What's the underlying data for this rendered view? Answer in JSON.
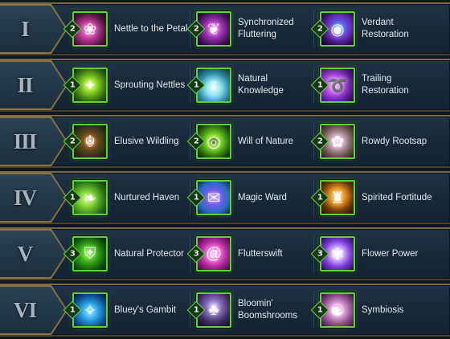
{
  "tiers": [
    {
      "numeral": "I",
      "slots": [
        {
          "name": "Nettle to the Petal",
          "rank": "2",
          "icon": "rose-icon",
          "bg": "radial-gradient(circle at 45% 55%, #f08fd0 0%, #c0389a 35%, #4a1338 70%, #1c0a18 100%)",
          "glyph": "❀"
        },
        {
          "name": "Synchronized Fluttering",
          "rank": "2",
          "icon": "butterfly-icon",
          "bg": "radial-gradient(circle at 50% 50%, #f27de9 0%, #9b2fb0 40%, #3c1050 75%, #150820 100%)",
          "glyph": "❦"
        },
        {
          "name": "Verdant Restoration",
          "rank": "2",
          "icon": "vortex-orb-icon",
          "bg": "radial-gradient(circle at 55% 45%, #8ad7ff 0%, #4a68e6 18%, #6d2fc4 45%, #2a1050 75%, #0c0620 100%)",
          "glyph": "◉"
        }
      ]
    },
    {
      "numeral": "II",
      "slots": [
        {
          "name": "Sprouting Nettles",
          "rank": "1",
          "icon": "sprout-burst-icon",
          "bg": "radial-gradient(circle at 50% 50%, #e9ff7a 0%, #8fd82a 30%, #3f7b14 65%, #122808 100%)",
          "glyph": "✦"
        },
        {
          "name": "Natural Knowledge",
          "rank": "1",
          "icon": "glowing-tree-icon",
          "bg": "radial-gradient(circle at 50% 60%, #e7ffff 0%, #8fe3f2 30%, #2d8ea5 60%, #0d2b38 100%)",
          "glyph": "♆"
        },
        {
          "name": "Trailing Restoration",
          "rank": "1",
          "icon": "swirl-trail-icon",
          "bg": "radial-gradient(circle at 40% 50%, #f0a6ff 0%, #b44ee2 35%, #5b1b93 70%, #1b0a30 100%)",
          "glyph": "➰"
        }
      ]
    },
    {
      "numeral": "III",
      "slots": [
        {
          "name": "Elusive Wildling",
          "rank": "2",
          "icon": "wildling-face-icon",
          "bg": "radial-gradient(circle at 50% 50%, #e08a2a 0%, #7a4a1a 30%, #2f3a16 65%, #101a08 100%)",
          "glyph": "☬"
        },
        {
          "name": "Will of Nature",
          "rank": "2",
          "icon": "green-spiral-icon",
          "bg": "radial-gradient(circle at 50% 50%, #1d3a08 0%, #8ee62a 25%, #4ea51a 50%, #1d4a0a 80%, #0c1e05 100%)",
          "glyph": "◎"
        },
        {
          "name": "Rowdy Rootsap",
          "rank": "2",
          "icon": "root-tendril-icon",
          "bg": "radial-gradient(circle at 50% 50%, #f6e0f0 0%, #c9a0b8 30%, #6a5a4a 65%, #221a14 100%)",
          "glyph": "✿"
        }
      ]
    },
    {
      "numeral": "IV",
      "slots": [
        {
          "name": "Nurtured Haven",
          "rank": "1",
          "icon": "haven-leaf-icon",
          "bg": "radial-gradient(circle at 40% 55%, #d8ff8a 0%, #7fd335 30%, #2f7a18 65%, #0e2508 100%)",
          "glyph": "❧"
        },
        {
          "name": "Magic Ward",
          "rank": "1",
          "icon": "scroll-ward-icon",
          "bg": "radial-gradient(circle at 50% 50%, #b28bff 0%, #6e58e8 35%, #2a6ec2 65%, #0d2440 100%)",
          "glyph": "✉"
        },
        {
          "name": "Spirited Fortitude",
          "rank": "1",
          "icon": "armored-guardian-icon",
          "bg": "radial-gradient(circle at 50% 45%, #ffe07a 0%, #e08a1c 35%, #6a3a0a 65%, #1c0e04 100%)",
          "glyph": "♜"
        }
      ]
    },
    {
      "numeral": "V",
      "slots": [
        {
          "name": "Natural Protector",
          "rank": "3",
          "icon": "protector-shield-icon",
          "bg": "radial-gradient(circle at 45% 50%, #9cff4a 0%, #37b01a 35%, #135a0a 70%, #061a04 100%)",
          "glyph": "⛨"
        },
        {
          "name": "Flutterswift",
          "rank": "3",
          "icon": "pink-vortex-icon",
          "bg": "radial-gradient(circle at 50% 50%, #ffd0f4 0%, #f05ad2 30%, #a01f8c 65%, #3a0a34 100%)",
          "glyph": "@"
        },
        {
          "name": "Flower Power",
          "rank": "3",
          "icon": "violet-bloom-icon",
          "bg": "radial-gradient(circle at 50% 50%, #ffffff 0%, #d4b0ff 25%, #7a3ad8 60%, #1e0c48 100%)",
          "glyph": "✾"
        }
      ]
    },
    {
      "numeral": "VI",
      "slots": [
        {
          "name": "Bluey's Gambit",
          "rank": "1",
          "icon": "blue-spirit-icon",
          "bg": "radial-gradient(circle at 50% 55%, #8ef0ff 0%, #2aa0e8 35%, #0d4a8a 70%, #04142a 100%)",
          "glyph": "✧"
        },
        {
          "name": "Bloomin' Boomshrooms",
          "rank": "1",
          "icon": "mushroom-icon",
          "bg": "radial-gradient(circle at 50% 40%, #e8d6ff 0%, #8a6ac0 30%, #3a2a5a 65%, #120c1e 100%)",
          "glyph": "♣"
        },
        {
          "name": "Symbiosis",
          "rank": "1",
          "icon": "symbiosis-swirl-icon",
          "bg": "radial-gradient(circle at 50% 50%, #fff0fa 0%, #e0a0d8 30%, #8a4a8c 65%, #2a1228 100%)",
          "glyph": "☯"
        }
      ]
    }
  ]
}
